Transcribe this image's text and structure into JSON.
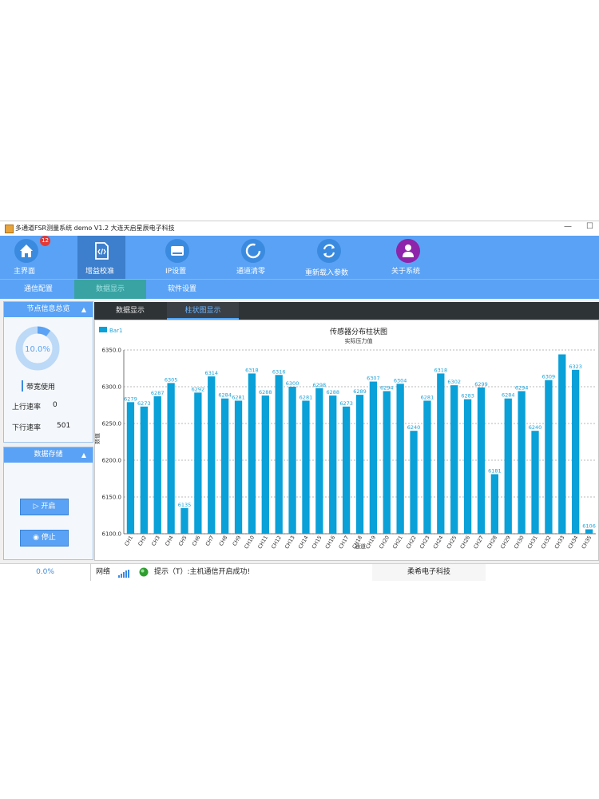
{
  "window": {
    "title": "多通道FSR测量系统 demo V1.2   大连天启星辰电子科技",
    "minimize": "—",
    "maximize": "☐"
  },
  "toolbar": {
    "items": [
      {
        "label": "主界面",
        "icon": "home-icon",
        "color": "#3a8ae0",
        "badge": "12"
      },
      {
        "label": "增益校准",
        "icon": "code-file-icon",
        "color": "#3a8ae0"
      },
      {
        "label": "IP设置",
        "icon": "drive-icon",
        "color": "#3a8ae0"
      },
      {
        "label": "通道清零",
        "icon": "refresh-circle-icon",
        "color": "#3a8ae0"
      },
      {
        "label": "重新载入参数",
        "icon": "reload-icon",
        "color": "#3a8ae0"
      },
      {
        "label": "关于系统",
        "icon": "user-icon",
        "color": "#8e24aa"
      }
    ]
  },
  "subnav": {
    "tabs": [
      "通信配置",
      "数据显示",
      "软件设置"
    ],
    "active": 1
  },
  "node_panel": {
    "title": "节点信息总览",
    "gauge_value": 0.1,
    "gauge_text": "10.0%",
    "bandwidth_label": "带宽使用",
    "up_label": "上行速率",
    "up_value": "0",
    "down_label": "下行速率",
    "down_value": "501"
  },
  "storage_panel": {
    "title": "数据存储",
    "start_label": "开启",
    "stop_label": "停止"
  },
  "view_tabs": {
    "tabs": [
      "数据显示",
      "柱状图显示"
    ],
    "active": 1
  },
  "chart_data": {
    "type": "bar",
    "title": "传感器分布柱状图",
    "subtitle": "实际压力值",
    "xlabel": "通道",
    "ylabel": "数值",
    "legend": "Bar1",
    "legend_position": "top-left",
    "bar_color": "#0aa0d8",
    "label_color": "#1ea2d9",
    "grid": true,
    "ylim": [
      6100,
      6350
    ],
    "yticks": [
      "6100.0",
      "6150.0",
      "6200.0",
      "6250.0",
      "6300.0",
      "6350.0"
    ],
    "categories": [
      "CH1",
      "CH2",
      "CH3",
      "CH4",
      "CH5",
      "CH6",
      "CH7",
      "CH8",
      "CH9",
      "CH10",
      "CH11",
      "CH12",
      "CH13",
      "CH14",
      "CH15",
      "CH16",
      "CH17",
      "CH18",
      "CH19",
      "CH20",
      "CH21",
      "CH22",
      "CH23",
      "CH24",
      "CH25",
      "CH26",
      "CH27",
      "CH28",
      "CH29",
      "CH30",
      "CH31",
      "CH32",
      "CH33",
      "CH34",
      "CH35"
    ],
    "values": [
      6279,
      6273,
      6287,
      6305,
      6135,
      6292,
      6314,
      6284,
      6281,
      6318,
      6288,
      6316,
      6300,
      6281,
      6298,
      6288,
      6273,
      6289,
      6307,
      6294,
      6304,
      6240,
      6281,
      6318,
      6302,
      6283,
      6299,
      6181,
      6284,
      6294,
      6240,
      6309,
      6344,
      6323,
      6106
    ],
    "data_labels": [
      "6279",
      "6273",
      "6287",
      "6305",
      "6135",
      "6292",
      "6314",
      "6284",
      "6281",
      "6318",
      "6288",
      "6316",
      "6300",
      "6281",
      "6298",
      "6288",
      "6273",
      "6289",
      "6307",
      "6294",
      "6304",
      "6240",
      "6281",
      "6318",
      "6302",
      "6283",
      "6299",
      "6181",
      "6284",
      "6294",
      "6240",
      "6309",
      "",
      "6323",
      "6106"
    ]
  },
  "status": {
    "percent": "0.0%",
    "network_label": "网络",
    "message": "提示（T）:主机通信开启成功!",
    "company": "柔希电子科技"
  }
}
